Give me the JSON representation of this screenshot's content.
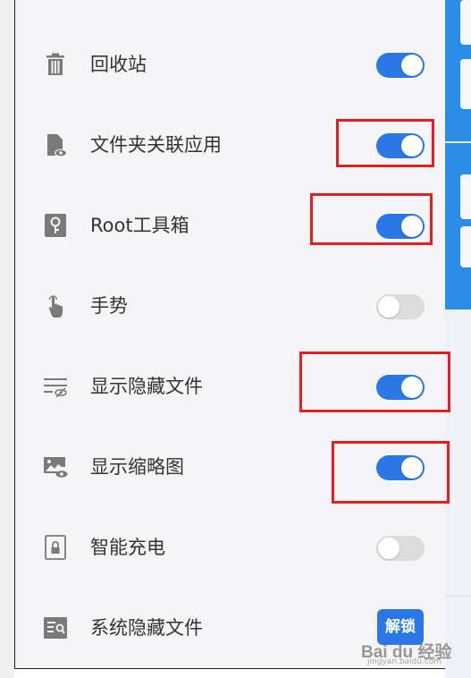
{
  "settings": {
    "items": [
      {
        "label": "回收站",
        "icon": "trash-icon",
        "control": "toggle",
        "on": true
      },
      {
        "label": "文件夹关联应用",
        "icon": "folder-link-icon",
        "control": "toggle",
        "on": true
      },
      {
        "label": "Root工具箱",
        "icon": "root-toolbox-icon",
        "control": "toggle",
        "on": true
      },
      {
        "label": "手势",
        "icon": "gesture-hand-icon",
        "control": "toggle",
        "on": false
      },
      {
        "label": "显示隐藏文件",
        "icon": "hidden-files-icon",
        "control": "toggle",
        "on": true
      },
      {
        "label": "显示缩略图",
        "icon": "thumbnail-icon",
        "control": "toggle",
        "on": true
      },
      {
        "label": "智能充电",
        "icon": "smart-charge-icon",
        "control": "toggle",
        "on": false
      },
      {
        "label": "系统隐藏文件",
        "icon": "system-hidden-files-icon",
        "control": "button",
        "button_label": "解锁"
      }
    ]
  },
  "colors": {
    "accent": "#2a78e8",
    "toggle_off": "#dcdcdc",
    "highlight": "#e51e1e",
    "text": "#333333",
    "background": "#f5f5f7"
  },
  "watermark": {
    "brand": "Bai du 经验",
    "url": "jingyan.baidu.com"
  }
}
